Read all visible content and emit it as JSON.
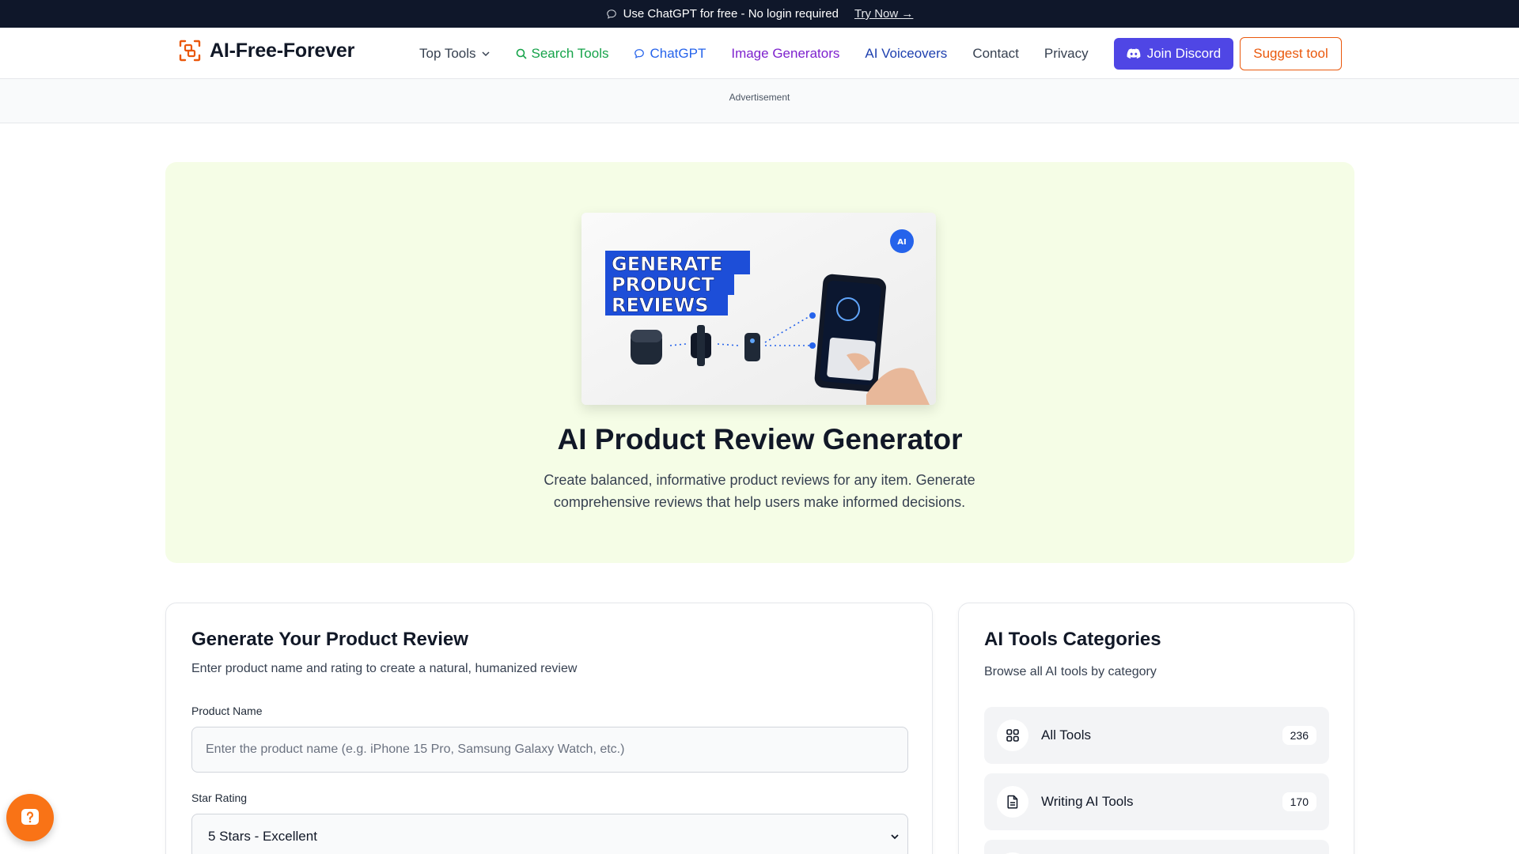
{
  "promo": {
    "text": "Use ChatGPT for free - No login required",
    "link": "Try Now →"
  },
  "header": {
    "brand": "AI-Free-Forever",
    "nav": [
      {
        "label": "Top Tools",
        "icon": "chevron-down-icon"
      },
      {
        "label": "Search Tools",
        "icon": "search-icon"
      },
      {
        "label": "ChatGPT",
        "icon": "chat-icon"
      },
      {
        "label": "Image Generators"
      },
      {
        "label": "AI Voiceovers"
      },
      {
        "label": "Contact"
      },
      {
        "label": "Privacy"
      }
    ],
    "discord_label": "Join Discord",
    "suggest_label": "Suggest tool"
  },
  "ad": {
    "label": "Advertisement"
  },
  "hero": {
    "image_text": [
      "GENERATE",
      "PRODUCT",
      "REVIEWS"
    ],
    "image_badge": "AI",
    "title": "AI Product Review Generator",
    "description": "Create balanced, informative product reviews for any item. Generate comprehensive reviews that help users make informed decisions."
  },
  "form": {
    "title": "Generate Your Product Review",
    "subtitle": "Enter product name and rating to create a natural, humanized review",
    "product_label": "Product Name",
    "product_placeholder": "Enter the product name (e.g. iPhone 15 Pro, Samsung Galaxy Watch, etc.)",
    "rating_label": "Star Rating",
    "rating_value": "5 Stars - Excellent"
  },
  "categories": {
    "title": "AI Tools Categories",
    "subtitle": "Browse all AI tools by category",
    "items": [
      {
        "label": "All Tools",
        "count": "236",
        "icon": "grid-icon"
      },
      {
        "label": "Writing AI Tools",
        "count": "170",
        "icon": "document-icon"
      }
    ]
  },
  "colors": {
    "promo_bg": "#0f172a",
    "discord": "#4f46e5",
    "accent_orange": "#ea580c",
    "hero_bg": "#f5fde6"
  }
}
